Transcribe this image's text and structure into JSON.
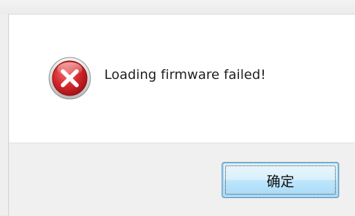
{
  "dialog": {
    "message": "Loading firmware failed!",
    "icon": "error-icon",
    "ok_label": "确定"
  },
  "colors": {
    "icon_red": "#c9262b",
    "button_border": "#3c7fb1"
  }
}
